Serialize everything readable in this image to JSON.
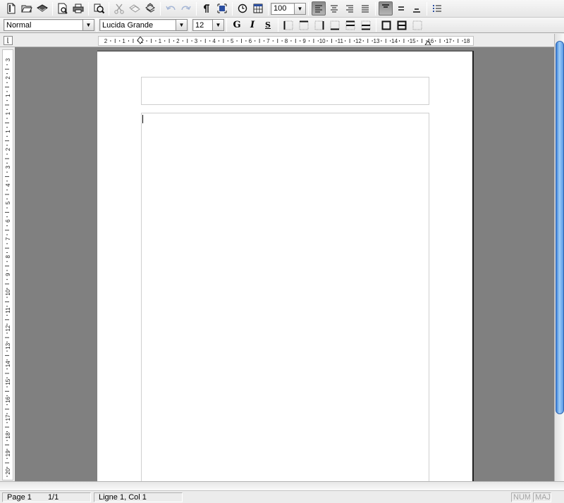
{
  "toolbar": {
    "zoom_value": "100"
  },
  "format_bar": {
    "style_value": "Normal",
    "font_value": "Lucida Grande",
    "size_value": "12",
    "bold_label": "G",
    "italic_label": "I",
    "underline_label": "S"
  },
  "rulers": {
    "horizontal_labels": [
      "2",
      "1",
      "1",
      "1",
      "2",
      "3",
      "4",
      "5",
      "6",
      "7",
      "8",
      "9",
      "10",
      "11",
      "12",
      "13",
      "14",
      "15",
      "16",
      "17",
      "18"
    ],
    "vertical_labels": [
      "3",
      "2",
      "1",
      "1",
      "1",
      "2",
      "3",
      "4",
      "5",
      "6",
      "7",
      "8",
      "9",
      "10",
      "11",
      "12",
      "13",
      "14",
      "15",
      "16",
      "17",
      "18",
      "19",
      "20"
    ]
  },
  "status": {
    "page_label": "Page 1",
    "page_count": "1/1",
    "position": "Ligne 1, Col 1",
    "num": "NUM",
    "maj": "MAJ"
  },
  "colors": {
    "canvas": "#808080",
    "page": "#ffffff",
    "scroll_thumb": "#3a7fd6",
    "pressed_button": "#8a8a8a"
  }
}
